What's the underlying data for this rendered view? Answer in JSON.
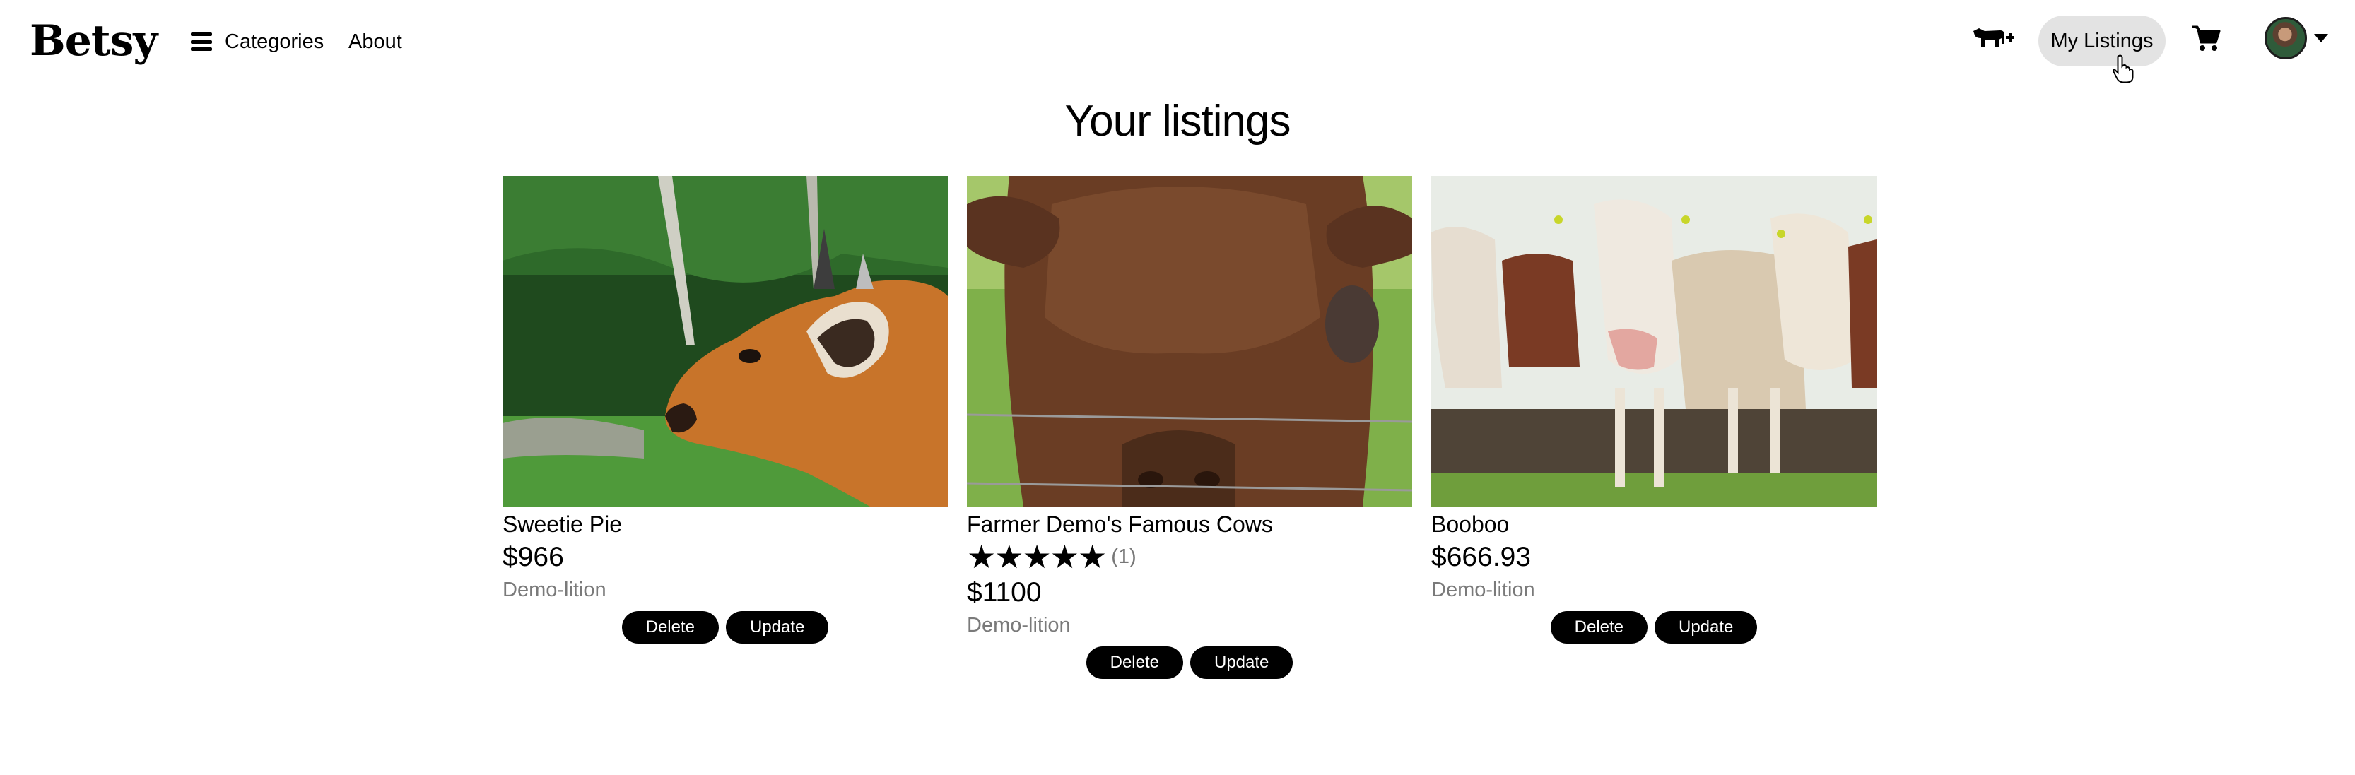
{
  "nav": {
    "logo": "Betsy",
    "categories_label": "Categories",
    "about_label": "About",
    "add_listing_icon": "cow-plus-icon",
    "my_listings_label": "My Listings",
    "cart_icon": "cart-icon"
  },
  "page": {
    "title": "Your listings"
  },
  "listings": [
    {
      "name": "Sweetie Pie",
      "price": "$966",
      "seller": "Demo-lition",
      "image": "brown-cow-profile-photo",
      "delete_label": "Delete",
      "update_label": "Update"
    },
    {
      "name": "Farmer Demo's Famous Cows",
      "stars": "★★★★★",
      "rating_count": "(1)",
      "price": "$1100",
      "seller": "Demo-lition",
      "image": "bull-behind-fence-photo",
      "delete_label": "Delete",
      "update_label": "Update"
    },
    {
      "name": "Booboo",
      "price": "$666.93",
      "seller": "Demo-lition",
      "image": "cow-herd-field-photo",
      "delete_label": "Delete",
      "update_label": "Update"
    }
  ]
}
